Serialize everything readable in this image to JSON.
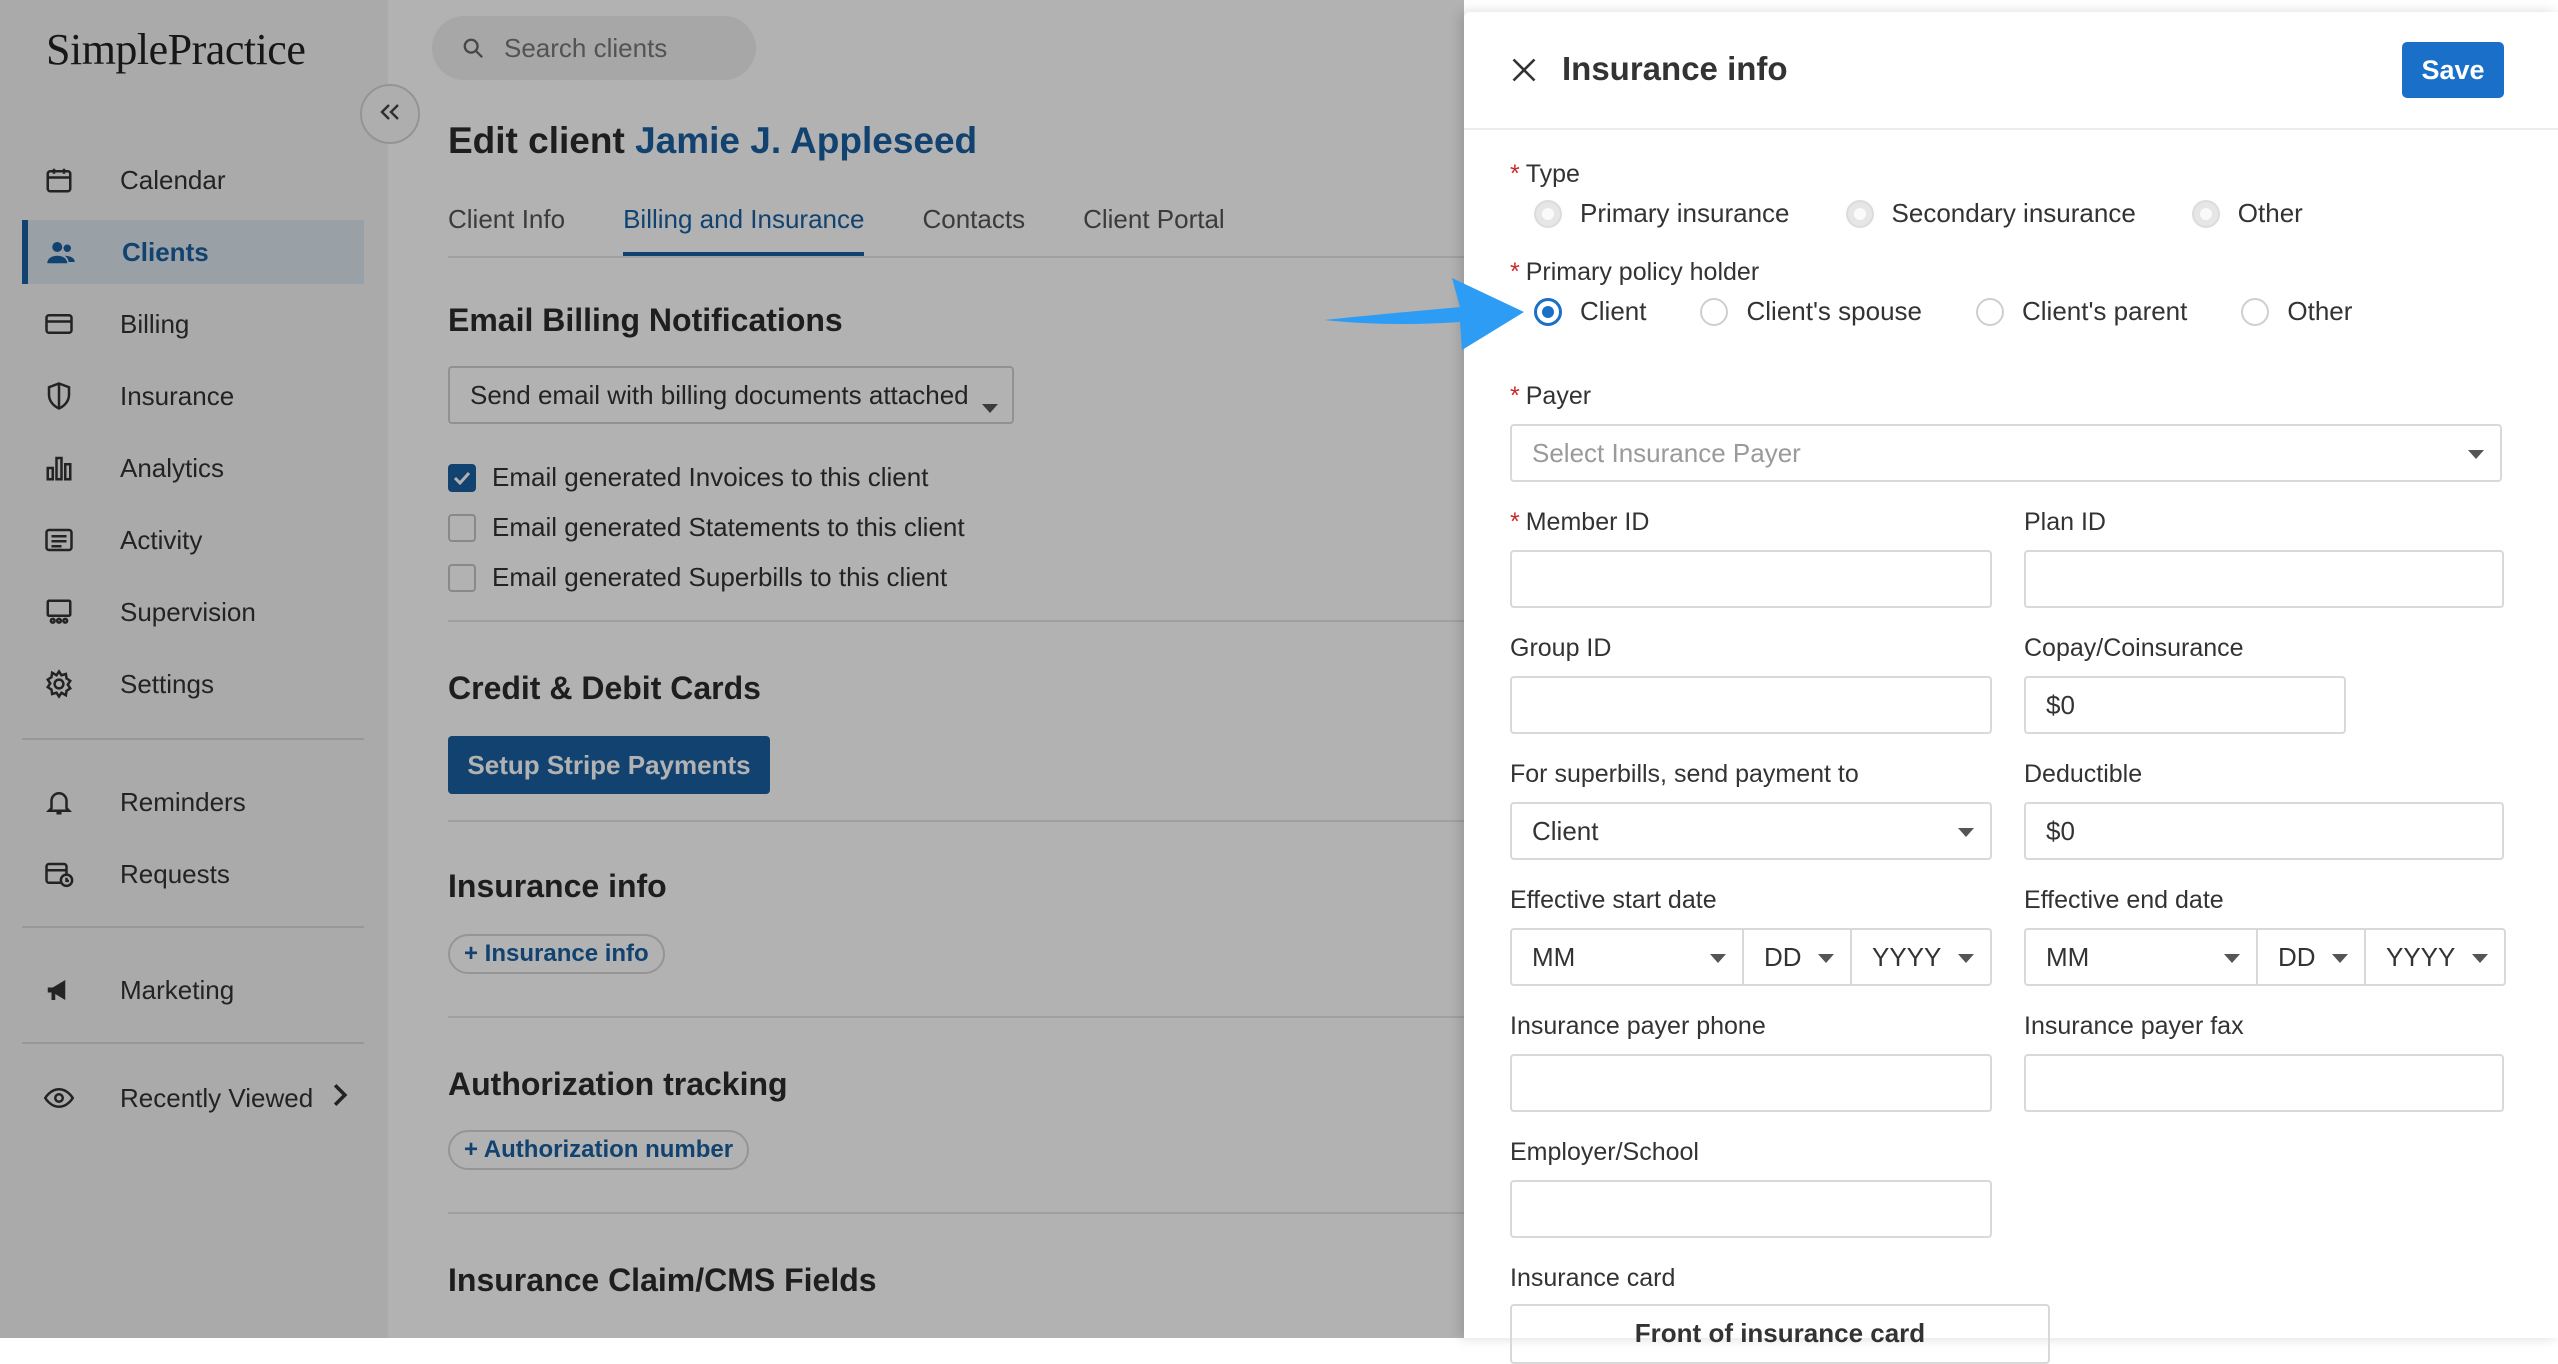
{
  "app": {
    "logo_text": "SimplePractice"
  },
  "sidebar": {
    "items": [
      {
        "label": "Calendar",
        "icon": "calendar-icon"
      },
      {
        "label": "Clients",
        "icon": "users-icon",
        "active": true
      },
      {
        "label": "Billing",
        "icon": "credit-card-icon"
      },
      {
        "label": "Insurance",
        "icon": "shield-icon"
      },
      {
        "label": "Analytics",
        "icon": "bar-chart-icon"
      },
      {
        "label": "Activity",
        "icon": "list-icon"
      },
      {
        "label": "Supervision",
        "icon": "supervision-icon"
      },
      {
        "label": "Settings",
        "icon": "gear-icon"
      },
      {
        "label": "Reminders",
        "icon": "bell-icon"
      },
      {
        "label": "Requests",
        "icon": "calendar-clock-icon"
      },
      {
        "label": "Marketing",
        "icon": "megaphone-icon"
      },
      {
        "label": "Recently Viewed",
        "icon": "eye-icon"
      }
    ]
  },
  "search": {
    "placeholder": "Search clients"
  },
  "main": {
    "title_prefix": "Edit client",
    "client_name": "Jamie J. Appleseed",
    "tabs": [
      "Client Info",
      "Billing and Insurance",
      "Contacts",
      "Client Portal"
    ],
    "active_tab": "Billing and Insurance",
    "email_section": {
      "title": "Email Billing Notifications",
      "select_value": "Send email with billing documents attached",
      "checkboxes": [
        {
          "label": "Email generated Invoices to this client",
          "checked": true
        },
        {
          "label": "Email generated Statements to this client",
          "checked": false
        },
        {
          "label": "Email generated Superbills to this client",
          "checked": false
        }
      ]
    },
    "cards_section": {
      "title": "Credit & Debit Cards",
      "button": "Setup Stripe Payments"
    },
    "insurance_section": {
      "title": "Insurance info",
      "link": "+ Insurance info"
    },
    "auth_section": {
      "title": "Authorization tracking",
      "link": "+ Authorization number"
    },
    "claim_section": {
      "title": "Insurance Claim/CMS Fields"
    }
  },
  "drawer": {
    "title": "Insurance info",
    "save_label": "Save",
    "required_mark": "*",
    "type": {
      "label": "Type",
      "options": [
        "Primary insurance",
        "Secondary insurance",
        "Other"
      ]
    },
    "policy_holder": {
      "label": "Primary policy holder",
      "options": [
        "Client",
        "Client's spouse",
        "Client's parent",
        "Other"
      ],
      "selected": "Client"
    },
    "payer": {
      "label": "Payer",
      "placeholder": "Select Insurance Payer"
    },
    "member_id": {
      "label": "Member ID",
      "value": ""
    },
    "plan_id": {
      "label": "Plan ID",
      "value": ""
    },
    "group_id": {
      "label": "Group ID",
      "value": ""
    },
    "copay": {
      "label": "Copay/Coinsurance",
      "value": "$0"
    },
    "superbills": {
      "label": "For superbills, send payment to",
      "value": "Client"
    },
    "deductible": {
      "label": "Deductible",
      "value": "$0"
    },
    "start_date": {
      "label": "Effective start date",
      "mm": "MM",
      "dd": "DD",
      "yyyy": "YYYY"
    },
    "end_date": {
      "label": "Effective end date",
      "mm": "MM",
      "dd": "DD",
      "yyyy": "YYYY"
    },
    "payer_phone": {
      "label": "Insurance payer phone",
      "value": ""
    },
    "payer_fax": {
      "label": "Insurance payer fax",
      "value": ""
    },
    "employer": {
      "label": "Employer/School",
      "value": ""
    },
    "card": {
      "label": "Insurance card",
      "front_label": "Front of insurance card"
    }
  },
  "colors": {
    "brand_blue": "#1a5fa0",
    "save_blue": "#1a6fc8",
    "arrow_blue": "#2d9cf5",
    "required_red": "#c92a2a"
  }
}
